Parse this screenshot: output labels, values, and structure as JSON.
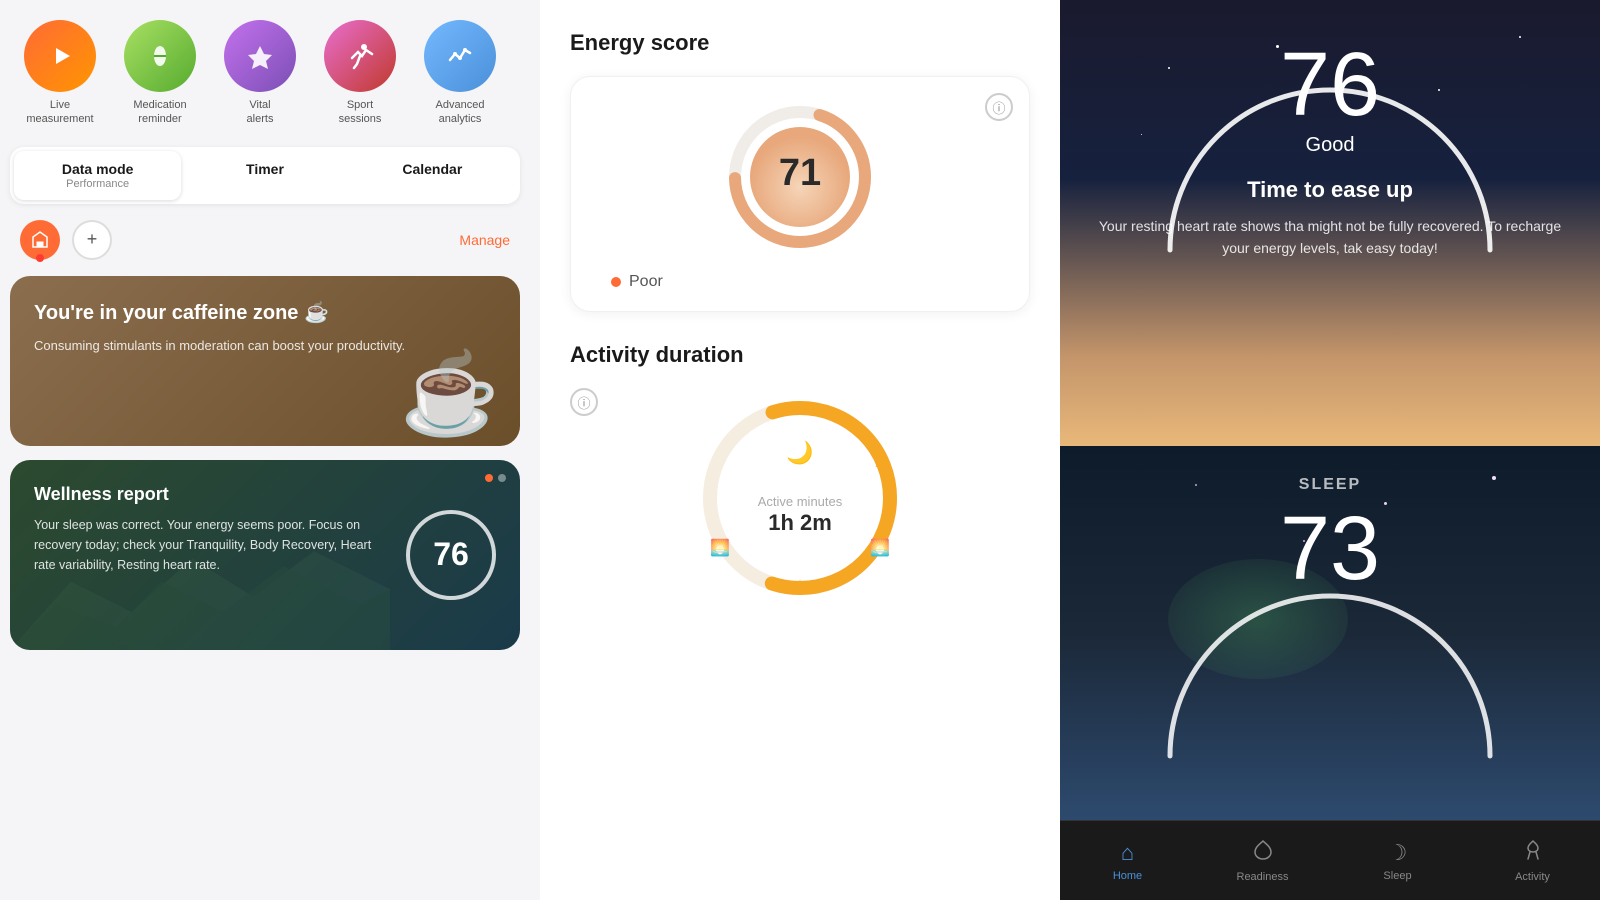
{
  "left": {
    "icons": [
      {
        "id": "live",
        "label": "Live\nmeasurement",
        "emoji": "▶",
        "color": "icon-orange"
      },
      {
        "id": "medication",
        "label": "Medication\nreminder",
        "emoji": "💊",
        "color": "icon-green"
      },
      {
        "id": "vital",
        "label": "Vital\nalerts",
        "emoji": "🔔",
        "color": "icon-purple"
      },
      {
        "id": "sport",
        "label": "Sport\nsessions",
        "emoji": "🏃",
        "color": "icon-pink"
      },
      {
        "id": "analytics",
        "label": "Advanced\nanalytics",
        "emoji": "📈",
        "color": "icon-blue"
      }
    ],
    "tabs": [
      {
        "id": "data",
        "title": "Data mode",
        "sub": "Performance",
        "active": true
      },
      {
        "id": "timer",
        "title": "Timer",
        "sub": "",
        "active": false
      },
      {
        "id": "calendar",
        "title": "Calendar",
        "sub": "",
        "active": false
      }
    ],
    "manage_label": "Manage",
    "caffeine": {
      "title": "You're in your caffeine zone ☕",
      "desc": "Consuming stimulants in moderation can boost your productivity."
    },
    "wellness": {
      "title": "Wellness report",
      "desc": "Your sleep was correct. Your energy seems poor. Focus on recovery today; check your Tranquility, Body Recovery, Heart rate variability, Resting heart rate.",
      "score": "76"
    }
  },
  "middle": {
    "energy_title": "Energy score",
    "energy_value": "71",
    "energy_legend": "Poor",
    "activity_title": "Activity duration",
    "activity_minutes_label": "Active minutes",
    "activity_value": "1h 2m"
  },
  "right": {
    "readiness": {
      "score": "76",
      "quality": "Good",
      "subtitle": "Time to ease up",
      "desc": "Your resting heart rate shows tha\nmight not be fully recovered. To\nrecharge your energy levels, tak\neasy today!"
    },
    "sleep": {
      "label": "SLEEP",
      "score": "73"
    },
    "nav": [
      {
        "id": "home",
        "label": "Home",
        "icon": "⌂",
        "active": true
      },
      {
        "id": "readiness",
        "label": "Readiness",
        "icon": "◈",
        "active": false
      },
      {
        "id": "sleep",
        "label": "Sleep",
        "icon": "☽",
        "active": false
      },
      {
        "id": "activity",
        "label": "Activity",
        "icon": "🔥",
        "active": false
      }
    ]
  }
}
